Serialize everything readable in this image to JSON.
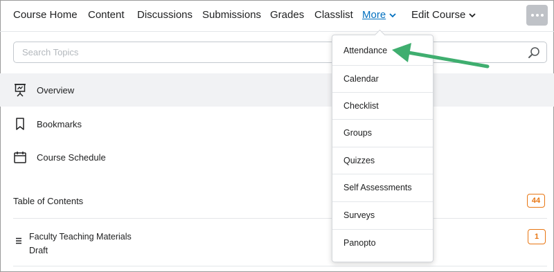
{
  "nav": {
    "items": [
      {
        "label": "Course Home"
      },
      {
        "label": "Content"
      },
      {
        "label": "Discussions"
      },
      {
        "label": "Submissions"
      },
      {
        "label": "Grades"
      },
      {
        "label": "Classlist"
      },
      {
        "label": "More",
        "active": true
      },
      {
        "label": "Edit Course"
      }
    ],
    "overflow_icon": "ellipsis-icon"
  },
  "search": {
    "placeholder": "Search Topics",
    "value": "",
    "icon": "search-icon"
  },
  "sidebar": {
    "items": [
      {
        "label": "Overview",
        "icon": "presentation-board-icon",
        "selected": true
      },
      {
        "label": "Bookmarks",
        "icon": "bookmark-icon"
      },
      {
        "label": "Course Schedule",
        "icon": "calendar-icon"
      }
    ],
    "toc": {
      "label": "Table of Contents",
      "count": "44"
    },
    "modules": [
      {
        "title": "Faculty Teaching Materials",
        "status": "Draft",
        "count": "1",
        "icon": "drag-handle-icon"
      }
    ]
  },
  "more_menu": {
    "items": [
      {
        "label": "Attendance"
      },
      {
        "label": "Calendar"
      },
      {
        "label": "Checklist"
      },
      {
        "label": "Groups"
      },
      {
        "label": "Quizzes"
      },
      {
        "label": "Self Assessments"
      },
      {
        "label": "Surveys"
      },
      {
        "label": "Panopto"
      }
    ]
  },
  "colors": {
    "link": "#006fbf",
    "badge": "#e87511",
    "annotation_arrow": "#3fae6f",
    "selected_row": "#f1f2f4"
  }
}
